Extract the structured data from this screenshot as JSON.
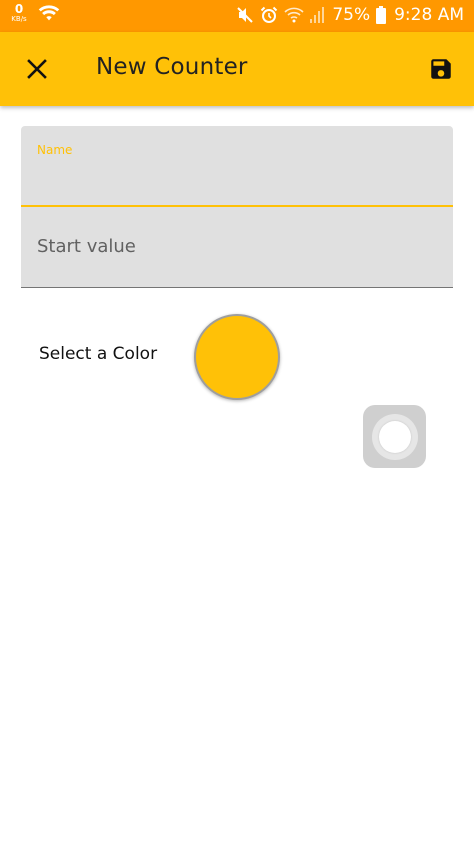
{
  "status_bar": {
    "kbs_value": "0",
    "kbs_unit": "KB/s",
    "battery": "75%",
    "time": "9:28 AM",
    "background": "#FF9800",
    "icons": [
      "wifi-icon",
      "mute-icon",
      "alarm-icon",
      "wifi-call-icon",
      "signal-icon",
      "battery-icon"
    ]
  },
  "app_bar": {
    "title": "New Counter",
    "close_icon": "close-icon",
    "save_icon": "save-icon",
    "background": "#FFC107"
  },
  "form": {
    "name_label": "Name",
    "name_value": "",
    "start_placeholder": "Start value",
    "start_value": "",
    "color_label": "Select a Color",
    "selected_color": "#FFC107",
    "accent": "#FFC107"
  }
}
